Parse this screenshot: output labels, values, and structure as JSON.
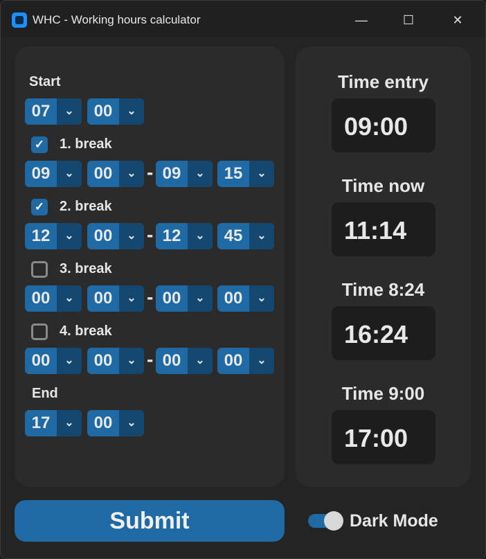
{
  "window": {
    "title": "WHC - Working hours calculator",
    "minimize_glyph": "—",
    "maximize_glyph": "☐",
    "close_glyph": "✕"
  },
  "left": {
    "start_label": "Start",
    "start": {
      "hour": "07",
      "minute": "00"
    },
    "breaks": [
      {
        "label": "1. break",
        "checked": true,
        "from_hour": "09",
        "from_minute": "00",
        "to_hour": "09",
        "to_minute": "15"
      },
      {
        "label": "2. break",
        "checked": true,
        "from_hour": "12",
        "from_minute": "00",
        "to_hour": "12",
        "to_minute": "45"
      },
      {
        "label": "3. break",
        "checked": false,
        "from_hour": "00",
        "from_minute": "00",
        "to_hour": "00",
        "to_minute": "00"
      },
      {
        "label": "4. break",
        "checked": false,
        "from_hour": "00",
        "from_minute": "00",
        "to_hour": "00",
        "to_minute": "00"
      }
    ],
    "separator": "-",
    "end_label": "End",
    "end": {
      "hour": "17",
      "minute": "00"
    },
    "check_glyph": "✓",
    "chevron_glyph": "⌄"
  },
  "right": {
    "entries": [
      {
        "label": "Time entry",
        "value": "09:00"
      },
      {
        "label": "Time now",
        "value": "11:14"
      },
      {
        "label": "Time 8:24",
        "value": "16:24"
      },
      {
        "label": "Time 9:00",
        "value": "17:00"
      }
    ]
  },
  "footer": {
    "submit_label": "Submit",
    "dark_mode_label": "Dark Mode",
    "dark_mode_on": true
  },
  "colors": {
    "accent": "#1f6aa5",
    "accent_dark": "#144870",
    "panel": "#2b2b2b",
    "background": "#242424"
  }
}
